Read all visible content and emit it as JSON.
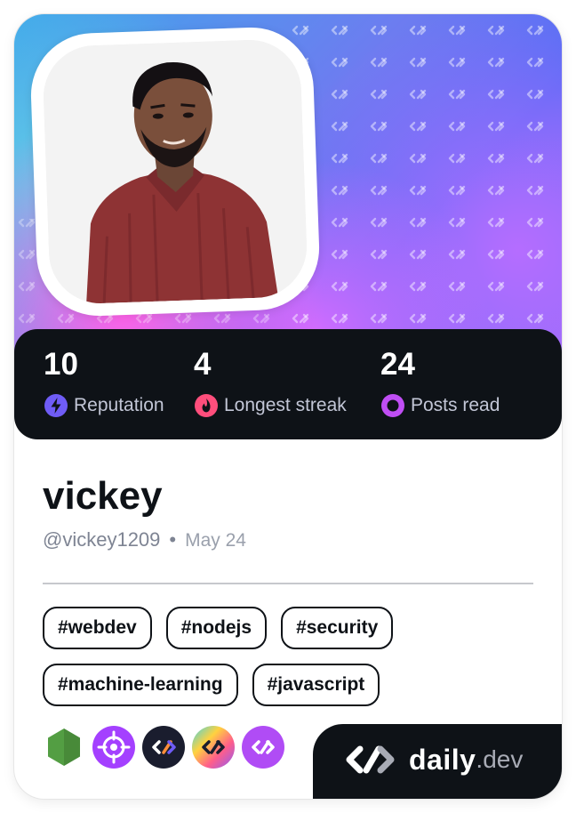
{
  "profile": {
    "name": "vickey",
    "handle": "@vickey1209",
    "separator": "•",
    "joined": "May 24"
  },
  "stats": [
    {
      "value": "10",
      "label": "Reputation",
      "icon": "bolt-icon",
      "color": "#6f5cf6"
    },
    {
      "value": "4",
      "label": "Longest streak",
      "icon": "flame-icon",
      "color": "#ff4e7c"
    },
    {
      "value": "24",
      "label": "Posts read",
      "icon": "eye-icon",
      "color": "#c04ef4"
    }
  ],
  "tags": [
    [
      "#webdev",
      "#nodejs",
      "#security"
    ],
    [
      "#machine-learning",
      "#javascript"
    ]
  ],
  "squads": [
    {
      "icon": "nodejs-hexagon-icon",
      "color": "#539e43"
    },
    {
      "icon": "crosshair-icon",
      "color": "#a440ff"
    },
    {
      "icon": "dark-link-icon",
      "color": "#1a1d2e"
    },
    {
      "icon": "rainbow-link-icon",
      "color": "#ff8c3a"
    },
    {
      "icon": "purple-link-icon",
      "color": "#b04cf5"
    }
  ],
  "brand": {
    "word": "daily",
    "suffix": ".dev"
  }
}
